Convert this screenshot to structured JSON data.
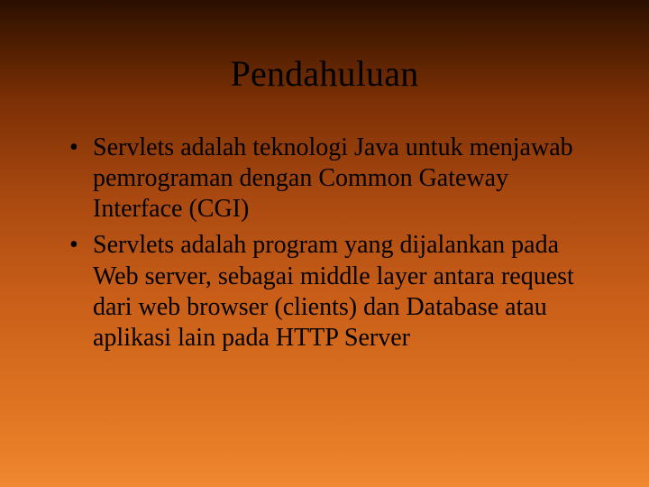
{
  "slide": {
    "title": "Pendahuluan",
    "bullets": [
      "Servlets adalah teknologi Java untuk menjawab pemrograman dengan Common Gateway Interface (CGI)",
      "Servlets adalah program yang dijalankan pada Web server, sebagai middle layer antara request dari web browser (clients) dan Database atau aplikasi lain pada HTTP Server"
    ]
  }
}
